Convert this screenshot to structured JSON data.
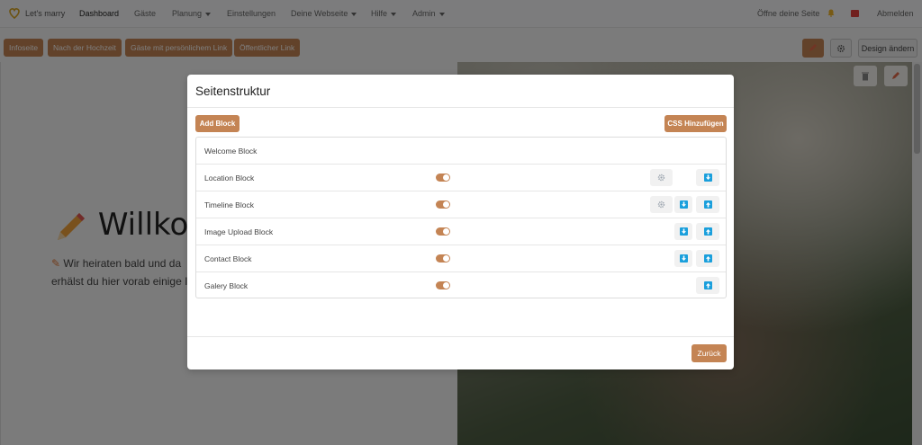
{
  "nav": {
    "brand": "Let's marry",
    "items": [
      {
        "label": "Dashboard"
      },
      {
        "label": "Gäste"
      },
      {
        "label": "Planung"
      },
      {
        "label": "Einstellungen"
      },
      {
        "label": "Deine Webseite"
      },
      {
        "label": "Hilfe"
      },
      {
        "label": "Admin"
      }
    ],
    "open_site": "Öffne deine Seite",
    "logout": "Abmelden"
  },
  "toolbar": {
    "tabs": [
      {
        "label": "Infoseite"
      },
      {
        "label": "Nach der Hochzeit"
      },
      {
        "label": "Gäste mit persönlichem Link"
      },
      {
        "label": "Öffentlicher Link"
      }
    ],
    "design_button": "Design ändern"
  },
  "page": {
    "welcome_title": "Willkom",
    "welcome_line1": "Wir heiraten bald und da",
    "welcome_line2": "erhälst du hier vorab einige In"
  },
  "modal": {
    "title": "Seitenstruktur",
    "add_block": "Add Block",
    "add_css": "CSS Hinzufügen",
    "back": "Zurück",
    "blocks": [
      {
        "label": "Welcome Block",
        "enabled": null,
        "settings": false,
        "down": false,
        "up": false
      },
      {
        "label": "Location Block",
        "enabled": true,
        "settings": true,
        "down": true,
        "up": false
      },
      {
        "label": "Timeline Block",
        "enabled": true,
        "settings": true,
        "down": true,
        "up": true
      },
      {
        "label": "Image Upload Block",
        "enabled": true,
        "settings": false,
        "down": true,
        "up": true
      },
      {
        "label": "Contact Block",
        "enabled": true,
        "settings": false,
        "down": true,
        "up": true
      },
      {
        "label": "Galery Block",
        "enabled": true,
        "settings": false,
        "down": false,
        "up": true
      }
    ]
  },
  "colors": {
    "accent": "#c48454",
    "arrow": "#1a9fdc"
  }
}
